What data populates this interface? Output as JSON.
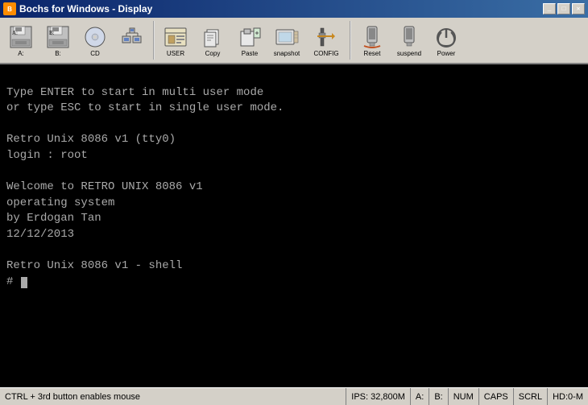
{
  "window": {
    "title": "Bochs for Windows - Display",
    "icon_label": "B"
  },
  "toolbar": {
    "buttons": [
      {
        "id": "floppy-a",
        "label": "A:",
        "type": "floppy-a"
      },
      {
        "id": "floppy-b",
        "label": "B:",
        "type": "floppy-b"
      },
      {
        "id": "cdrom",
        "label": "CD",
        "type": "cdrom"
      },
      {
        "id": "network",
        "label": "",
        "type": "network"
      },
      {
        "id": "user",
        "label": "USER",
        "type": "user"
      },
      {
        "id": "copy",
        "label": "Copy",
        "type": "copy"
      },
      {
        "id": "paste",
        "label": "Paste",
        "type": "paste"
      },
      {
        "id": "snapshot",
        "label": "snapshot",
        "type": "snapshot"
      },
      {
        "id": "config",
        "label": "CONFIG",
        "type": "config"
      },
      {
        "id": "reset",
        "label": "Reset",
        "type": "reset"
      },
      {
        "id": "suspend",
        "label": "suspend",
        "type": "suspend"
      },
      {
        "id": "power",
        "label": "Power",
        "type": "power"
      }
    ]
  },
  "terminal": {
    "lines": [
      "",
      "Type ENTER to start in multi user mode",
      "or type ESC to start in single user mode.",
      "",
      "Retro Unix 8086 v1 (tty0)",
      "login : root",
      "",
      "       Welcome to RETRO UNIX 8086 v1",
      "            operating system",
      "             by Erdogan Tan",
      "              12/12/2013",
      "",
      "Retro Unix 8086 v1 - shell",
      "#"
    ]
  },
  "statusbar": {
    "left": "CTRL + 3rd button enables mouse",
    "ips": "IPS: 32,800M",
    "a": "A:",
    "b": "B:",
    "num": "NUM",
    "caps": "CAPS",
    "scrl": "SCRL",
    "hd": "HD:0-M"
  }
}
